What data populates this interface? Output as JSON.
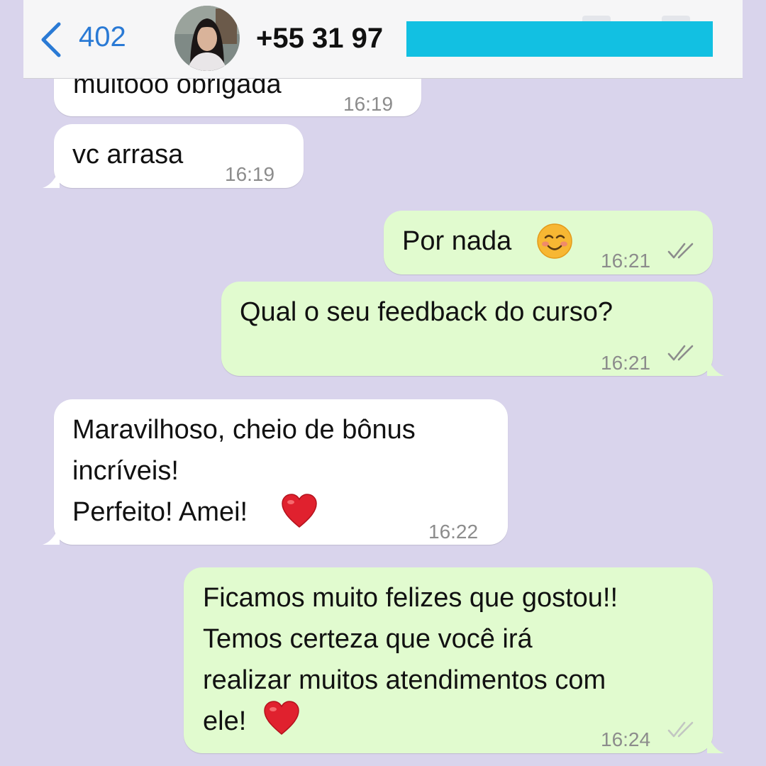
{
  "header": {
    "back_count": "402",
    "contact_name": "+55 31 97"
  },
  "messages": [
    {
      "direction": "in",
      "lines": [
        "muitooo obrigada"
      ],
      "time": "16:19"
    },
    {
      "direction": "in",
      "lines": [
        "vc arrasa"
      ],
      "time": "16:19"
    },
    {
      "direction": "out",
      "lines": [
        "Por nada"
      ],
      "emoji": "☺️",
      "time": "16:21",
      "status": "read"
    },
    {
      "direction": "out",
      "lines": [
        "Qual o seu feedback do curso?"
      ],
      "time": "16:21",
      "status": "read"
    },
    {
      "direction": "in",
      "lines": [
        "Maravilhoso, cheio de bônus",
        "incríveis!",
        "Perfeito! Amei!"
      ],
      "emoji": "❤️",
      "time": "16:22"
    },
    {
      "direction": "out",
      "lines": [
        "Ficamos muito felizes que gostou!!",
        "Temos certeza que você irá",
        "realizar muitos atendimentos com",
        "ele!"
      ],
      "emoji": "❤️",
      "time": "16:24",
      "status": "delivered"
    }
  ],
  "colors": {
    "background": "#d9d4ec",
    "incoming_bubble": "#ffffff",
    "outgoing_bubble": "#e1fbcf",
    "link_blue": "#2a7ad5",
    "redaction": "#12c0e2",
    "read_tick": "#8c8c8c"
  },
  "icons": [
    "chevron-left-icon",
    "double-check-icon",
    "smiling-face-emoji",
    "red-heart-emoji"
  ]
}
